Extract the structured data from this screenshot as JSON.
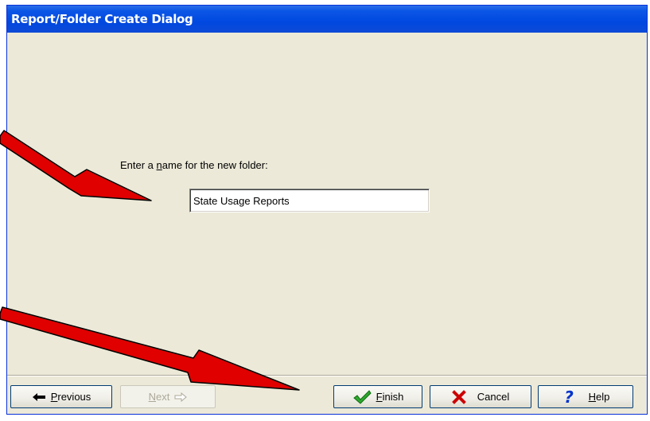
{
  "window": {
    "title": "Report/Folder Create Dialog"
  },
  "form": {
    "prompt_before": "Enter a ",
    "prompt_accel": "n",
    "prompt_after": "ame for the new folder:",
    "folder_name_value": "State Usage Reports"
  },
  "buttons": {
    "previous": {
      "accel": "P",
      "rest": "revious",
      "icon": "left-arrow-icon"
    },
    "next": {
      "accel": "N",
      "rest": "ext",
      "icon": "right-arrow-icon",
      "disabled": true
    },
    "finish": {
      "accel": "F",
      "rest": "inish",
      "icon": "checkmark-icon"
    },
    "cancel": {
      "label": "Cancel",
      "icon": "x-icon"
    },
    "help": {
      "accel": "H",
      "rest": "elp",
      "icon": "question-mark-icon"
    }
  },
  "colors": {
    "titlebar": "#0048e0",
    "dialog_bg": "#ece9d8",
    "annotation_arrow": "#e00000",
    "finish_check": "#2fa82f",
    "cancel_x": "#cc0000",
    "help_q": "#0033cc"
  }
}
